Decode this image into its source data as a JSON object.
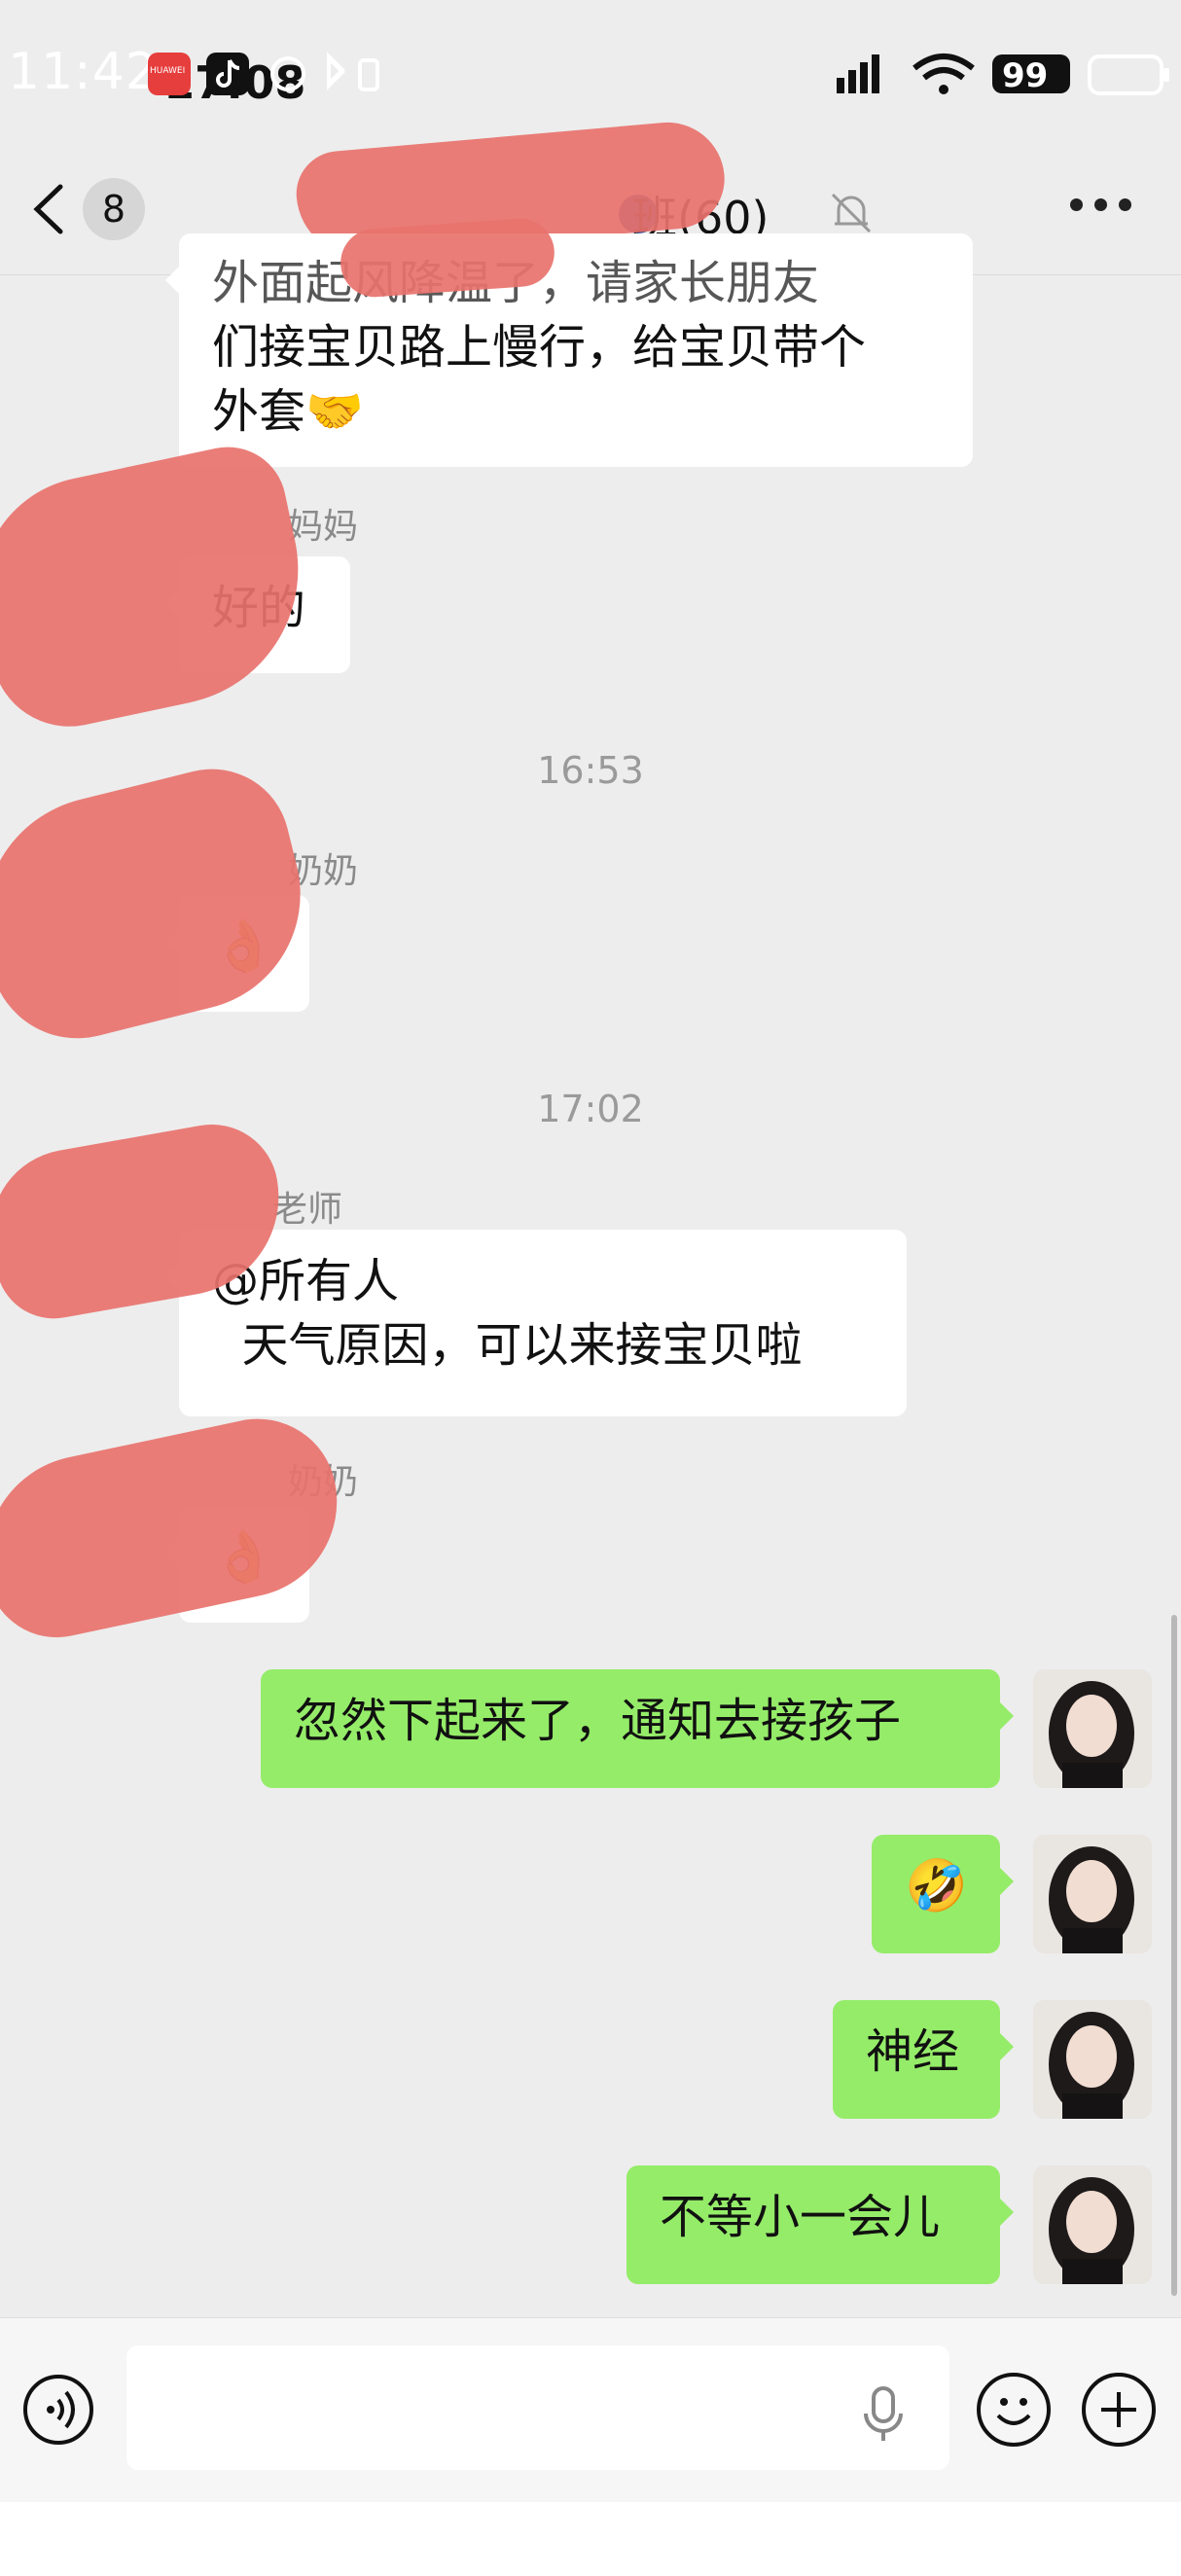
{
  "status_bar": {
    "time": "11:42",
    "time_overlay": "17:08",
    "battery": "99",
    "huawei_label": "HUAWEI"
  },
  "header": {
    "unread_count": "8",
    "title": "班(60)"
  },
  "messages": [
    {
      "side": "them",
      "sender": "",
      "text_lines": [
        "外面起风降温了，请家长朋友",
        "们接宝贝路上慢行，给宝贝带个",
        "外套🤝"
      ]
    },
    {
      "side": "them",
      "sender": "妈妈",
      "text_lines": [
        "好的"
      ]
    },
    {
      "timestamp": "16:53"
    },
    {
      "side": "them",
      "sender": "奶奶",
      "text_lines": [
        "👌"
      ]
    },
    {
      "timestamp": "17:02"
    },
    {
      "side": "them",
      "sender": "老师",
      "text_lines": [
        "@所有人",
        "  天气原因，可以来接宝贝啦"
      ]
    },
    {
      "side": "them",
      "sender": "奶奶",
      "text_lines": [
        "👌"
      ]
    },
    {
      "side": "me",
      "text_lines": [
        "忽然下起来了，通知去接孩子"
      ]
    },
    {
      "side": "me",
      "text_lines": [
        "🤣"
      ]
    },
    {
      "side": "me",
      "text_lines": [
        "神经"
      ]
    },
    {
      "side": "me",
      "text_lines": [
        "不等小一会儿"
      ]
    }
  ],
  "input_bar": {
    "placeholder": ""
  },
  "colors": {
    "background": "#ededed",
    "my_bubble": "#95ec69",
    "their_bubble": "#ffffff",
    "redaction": "#e8726c"
  },
  "icons": [
    "back-arrow-icon",
    "mute-bell-icon",
    "more-icon",
    "voice-icon",
    "mic-icon",
    "emoji-icon",
    "plus-icon"
  ]
}
